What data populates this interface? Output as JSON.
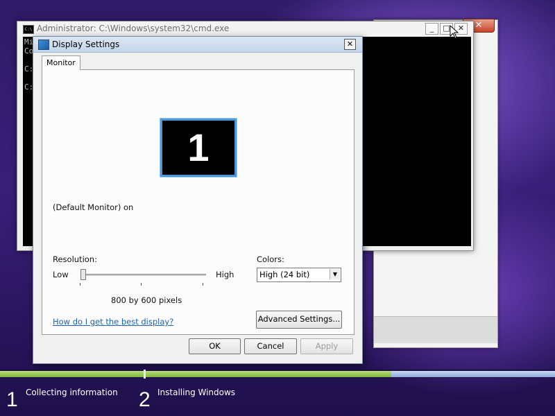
{
  "cmd_window": {
    "title": "Administrator: C:\\Windows\\system32\\cmd.exe",
    "icon_text": "C:\\",
    "minimize": "_",
    "maximize": "□",
    "close": "✕",
    "console_lines": [
      "Mi",
      "Co                                                              d.",
      "",
      "C:",
      "",
      "C:"
    ]
  },
  "display_dialog": {
    "title": "Display Settings",
    "close": "✕",
    "tab_label": "Monitor",
    "monitor_number": "1",
    "monitor_status": "(Default Monitor) on",
    "resolution_label": "Resolution:",
    "slider_low": "Low",
    "slider_high": "High",
    "resolution_value_fraction": 0.0,
    "resolution_text": "800 by 600 pixels",
    "colors_label": "Colors:",
    "colors_value": "High (24 bit)",
    "help_link": "How do I get the best display?",
    "advanced_button": "Advanced Settings...",
    "ok_button": "OK",
    "cancel_button": "Cancel",
    "apply_button": "Apply"
  },
  "background_window": {
    "close": "✕"
  },
  "setup_progress": {
    "step1_number": "1",
    "step1_label": "Collecting information",
    "step1_progress": 1.0,
    "step2_number": "2",
    "step2_label": "Installing Windows",
    "step2_progress": 0.6
  }
}
